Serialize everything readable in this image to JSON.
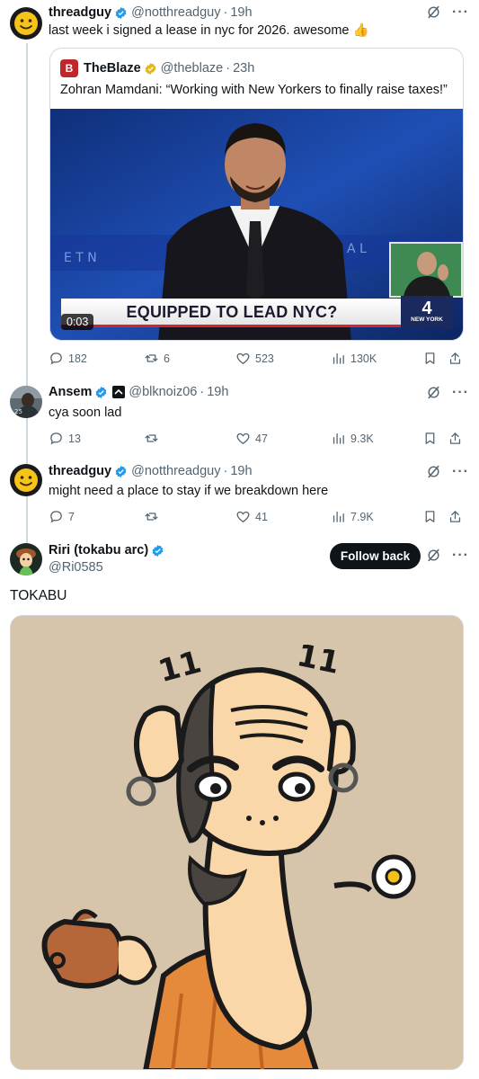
{
  "tweets": [
    {
      "name": "threadguy",
      "handle": "@notthreadguy",
      "time": "19h",
      "text": "last week i signed a lease in nyc for 2026. awesome 👍",
      "stats": {
        "replies": "182",
        "reposts": "6",
        "likes": "523",
        "views": "130K"
      }
    },
    {
      "name": "Ansem",
      "handle": "@blknoiz06",
      "time": "19h",
      "text": "cya soon lad",
      "stats": {
        "replies": "13",
        "reposts": "",
        "likes": "47",
        "views": "9.3K"
      }
    },
    {
      "name": "threadguy",
      "handle": "@notthreadguy",
      "time": "19h",
      "text": "might need a place to stay if we breakdown here",
      "stats": {
        "replies": "7",
        "reposts": "",
        "likes": "41",
        "views": "7.9K"
      }
    }
  ],
  "quote": {
    "name": "TheBlaze",
    "handle": "@theblaze",
    "time": "23h",
    "text": "Zohran Mamdani: “Working with New Yorkers to finally raise taxes!”",
    "video_time": "0:03",
    "chyron": "EQUIPPED TO LEAD NYC?",
    "logo_number": "4",
    "logo_caption": "NEW YORK"
  },
  "profile": {
    "name": "Riri (tokabu arc)",
    "handle": "@Ri0585",
    "follow_label": "Follow back",
    "post_text": "TOKABU"
  },
  "colors": {
    "verified": "#1d9bf0",
    "gold_badge": "#e2b719",
    "muted": "#536471",
    "border": "#cfd9de"
  }
}
